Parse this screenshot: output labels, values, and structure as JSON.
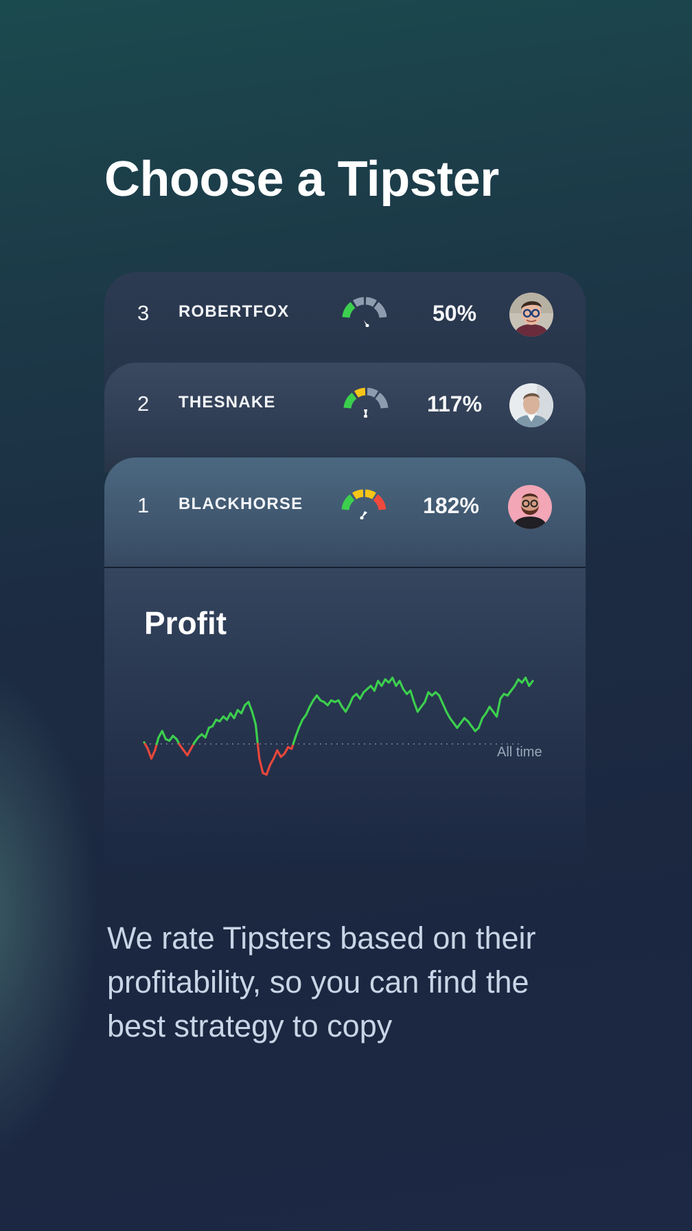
{
  "title": "Choose a Tipster",
  "tipsters": [
    {
      "rank": "3",
      "name": "ROBERTFOX",
      "percent": "50%",
      "avatar": "avatar-robertfox",
      "gauge_level": 0.25
    },
    {
      "rank": "2",
      "name": "THESNAKE",
      "percent": "117%",
      "avatar": "avatar-thesnake",
      "gauge_level": 0.5
    },
    {
      "rank": "1",
      "name": "BLACKHORSE",
      "percent": "182%",
      "avatar": "avatar-blackhorse",
      "gauge_level": 0.6
    }
  ],
  "profit": {
    "title": "Profit",
    "range_label": "All time"
  },
  "description": "We rate Tipsters based on their profitability, so you can find the best strategy to copy",
  "colors": {
    "positive": "#3ccf4e",
    "negative": "#e8473c",
    "gauge_green": "#3ccf4e",
    "gauge_yellow": "#f5c518",
    "gauge_red": "#ef4a3d",
    "gauge_gray": "#8f9caf"
  },
  "chart_data": {
    "type": "line",
    "title": "Profit",
    "xlabel": "",
    "ylabel": "",
    "baseline": 0,
    "grid": false,
    "series": [
      {
        "values": [
          0.1,
          -0.3,
          -0.9,
          -0.4,
          0.4,
          0.8,
          0.3,
          0.2,
          0.5,
          0.3,
          -0.1,
          -0.4,
          -0.7,
          -0.3,
          0.1,
          0.4,
          0.6,
          0.4,
          1.0,
          1.1,
          1.5,
          1.4,
          1.7,
          1.5,
          1.9,
          1.6,
          2.1,
          1.9,
          2.4,
          2.6,
          2.0,
          1.2,
          -0.9,
          -1.8,
          -1.9,
          -1.3,
          -0.9,
          -0.4,
          -0.8,
          -0.6,
          -0.2,
          -0.3,
          0.4,
          1.0,
          1.5,
          1.8,
          2.3,
          2.7,
          3.0,
          2.7,
          2.6,
          2.4,
          2.7,
          2.6,
          2.7,
          2.3,
          2.0,
          2.4,
          2.9,
          3.1,
          2.8,
          3.2,
          3.4,
          3.6,
          3.3,
          3.9,
          3.6,
          4.0,
          3.8,
          4.1,
          3.6,
          3.9,
          3.4,
          3.1,
          3.3,
          2.6,
          2.0,
          2.3,
          2.6,
          3.2,
          3.0,
          3.2,
          3.0,
          2.5,
          2.0,
          1.6,
          1.3,
          1.0,
          1.3,
          1.6,
          1.4,
          1.1,
          0.8,
          1.0,
          1.6,
          1.9,
          2.3,
          2.0,
          1.7,
          2.8,
          3.1,
          3.0,
          3.3,
          3.6,
          4.0,
          3.8,
          4.1,
          3.6,
          3.9
        ]
      }
    ]
  }
}
